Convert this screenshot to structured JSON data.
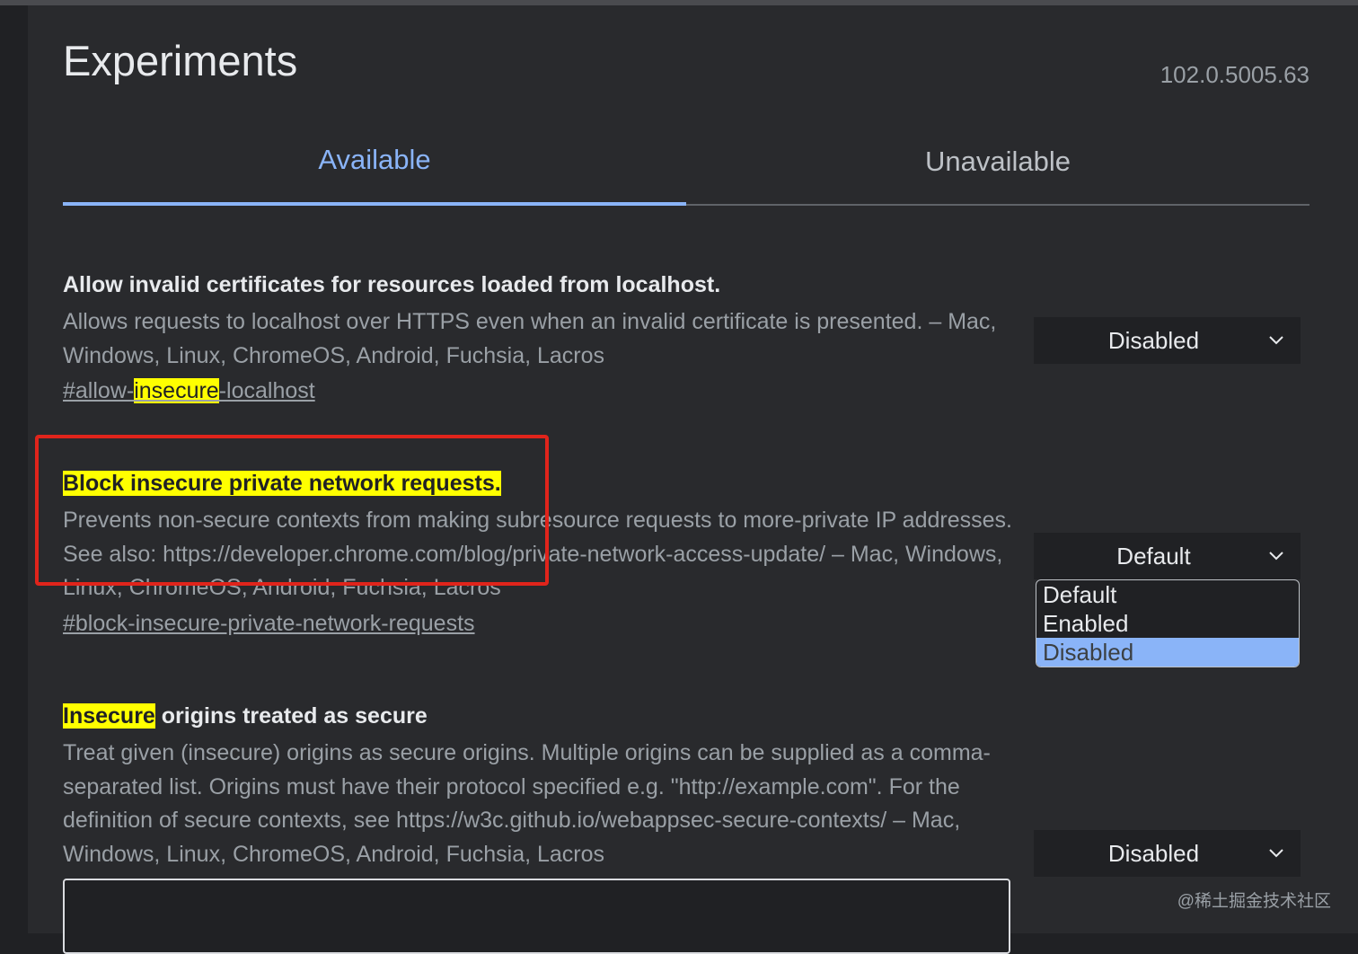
{
  "header": {
    "title": "Experiments",
    "version": "102.0.5005.63"
  },
  "tabs": [
    {
      "label": "Available",
      "active": true
    },
    {
      "label": "Unavailable",
      "active": false
    }
  ],
  "colors": {
    "accent": "#8ab4f8",
    "highlight": "#ffff00",
    "annotation": "#e0241b"
  },
  "experiments": [
    {
      "name_pre": "",
      "name_hl": "",
      "name_post": "Allow invalid certificates for resources loaded from localhost.",
      "desc": "Allows requests to localhost over HTTPS even when an invalid certificate is presented. – Mac, Windows, Linux, ChromeOS, Android, Fuchsia, Lacros",
      "link_pre": "#allow-",
      "link_hl": "insecure",
      "link_post": "-localhost",
      "select_value": "Disabled"
    },
    {
      "name_hl": "Block insecure private network requests.",
      "desc": "Prevents non-secure contexts from making subresource requests to more-private IP addresses. See also: https://developer.chrome.com/blog/private-network-access-update/ – Mac, Windows, Linux, ChromeOS, Android, Fuchsia, Lacros",
      "link": "#block-insecure-private-network-requests",
      "select_value": "Default",
      "options": [
        "Default",
        "Enabled",
        "Disabled"
      ],
      "highlighted_option": "Disabled"
    },
    {
      "name_hl": "Insecure",
      "name_post": " origins treated as secure",
      "desc": "Treat given (insecure) origins as secure origins. Multiple origins can be supplied as a comma-separated list. Origins must have their protocol specified e.g. \"http://example.com\". For the definition of secure contexts, see https://w3c.github.io/webappsec-secure-contexts/ – Mac, Windows, Linux, ChromeOS, Android, Fuchsia, Lacros",
      "select_value": "Disabled",
      "textarea_value": ""
    }
  ],
  "icons": {
    "dropdown": "chevron-down-icon"
  },
  "watermark": "@稀土掘金技术社区"
}
